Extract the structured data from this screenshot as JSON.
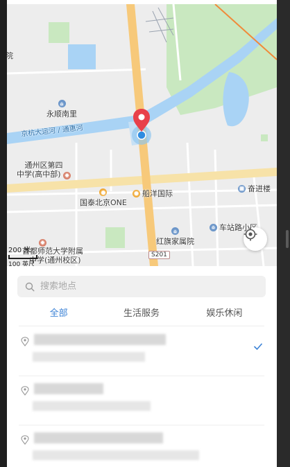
{
  "map": {
    "labels": {
      "yongshun": "永顺南里",
      "canal": "京杭大运河 / 通惠河",
      "school_line1": "通州区第四",
      "school_line2": "中学(高中部)",
      "chuanyang": "船洋国际",
      "guotai": "国泰北京ONE",
      "fenjin": "奋进楼",
      "chezhan": "车站路小区",
      "hongqi": "红旗家属院",
      "affiliate_line1": "首都师范大学附属",
      "affiliate_line2": "中学(通州校区)",
      "road": "S201",
      "edge": "院"
    },
    "scale": {
      "label": "200 米",
      "sublabel": "100 英尺"
    },
    "colors": {
      "road_major": "#f7c97a",
      "water": "#a9d3f5",
      "green": "#c9e8c0",
      "pin": "#e8404a",
      "location": "#2f8ce0"
    }
  },
  "sheet": {
    "search": {
      "placeholder": "搜索地点",
      "value": ""
    },
    "tabs": [
      {
        "label": "全部",
        "active": true
      },
      {
        "label": "生活服务",
        "active": false
      },
      {
        "label": "娱乐休闲",
        "active": false
      }
    ],
    "results": [
      {
        "selected": true
      },
      {
        "selected": false
      },
      {
        "selected": false
      }
    ],
    "accent_color": "#3b82d6"
  }
}
